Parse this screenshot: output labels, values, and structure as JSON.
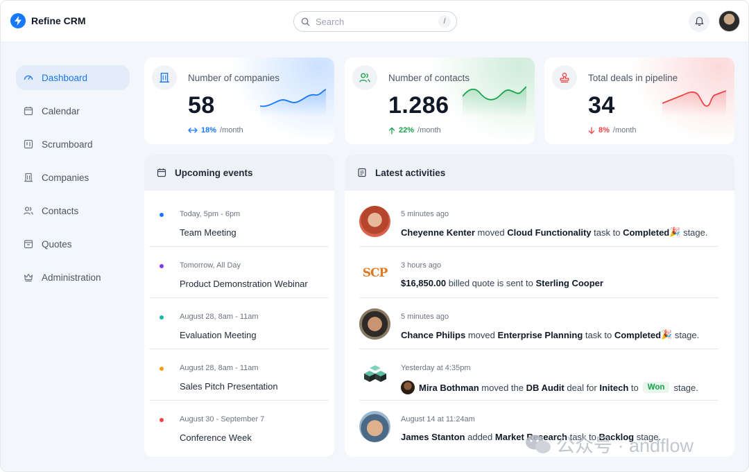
{
  "app": {
    "name": "Refine CRM"
  },
  "search": {
    "placeholder": "Search",
    "shortcut": "/"
  },
  "sidebar": {
    "items": [
      {
        "label": "Dashboard",
        "icon": "gauge-icon",
        "active": true
      },
      {
        "label": "Calendar",
        "icon": "calendar-icon"
      },
      {
        "label": "Scrumboard",
        "icon": "board-icon"
      },
      {
        "label": "Companies",
        "icon": "building-icon"
      },
      {
        "label": "Contacts",
        "icon": "users-icon"
      },
      {
        "label": "Quotes",
        "icon": "inbox-icon"
      },
      {
        "label": "Administration",
        "icon": "crown-icon"
      }
    ]
  },
  "kpis": [
    {
      "title": "Number of companies",
      "value": "58",
      "pct": "18%",
      "unit": "/month",
      "trend": "flat",
      "color": "#1677ff"
    },
    {
      "title": "Number of contacts",
      "value": "1.286",
      "pct": "22%",
      "unit": "/month",
      "trend": "up",
      "color": "#16a34a"
    },
    {
      "title": "Total deals in pipeline",
      "value": "34",
      "pct": "8%",
      "unit": "/month",
      "trend": "down",
      "color": "#ef4444"
    }
  ],
  "events": {
    "title": "Upcoming events",
    "items": [
      {
        "date": "Today, 5pm - 6pm",
        "title": "Team Meeting",
        "color": "#1677ff"
      },
      {
        "date": "Tomorrow, All Day",
        "title": "Product Demonstration Webinar",
        "color": "#7c3aed"
      },
      {
        "date": "August 28, 8am - 11am",
        "title": "Evaluation Meeting",
        "color": "#14b8a6"
      },
      {
        "date": "August 28, 8am - 11am",
        "title": "Sales Pitch Presentation",
        "color": "#f59e0b"
      },
      {
        "date": "August 30 - September 7",
        "title": "Conference Week",
        "color": "#ef4444"
      }
    ]
  },
  "activities": {
    "title": "Latest activities",
    "items": [
      {
        "time": "5 minutes ago",
        "parts": [
          "Cheyenne Kenter",
          "moved",
          "Cloud Functionality",
          "task to",
          "Completed",
          "stage."
        ]
      },
      {
        "time": "3 hours ago",
        "parts": [
          "$16,850.00",
          "billed quote is sent to",
          "Sterling Cooper"
        ],
        "logo_text": "SCP"
      },
      {
        "time": "5 minutes ago",
        "parts": [
          "Chance Philips",
          "moved",
          "Enterprise Planning",
          "task to",
          "Completed",
          "stage."
        ]
      },
      {
        "time": "Yesterday at 4:35pm",
        "parts": [
          "Mira Bothman",
          "moved the",
          "DB Audit",
          "deal for",
          "Initech",
          "to",
          "Won",
          "stage."
        ]
      },
      {
        "time": "August 14 at 11:24am",
        "parts": [
          "James Stanton",
          "added",
          "Market Research",
          "task to",
          "Backlog",
          "stage."
        ]
      }
    ]
  },
  "watermark": {
    "text": "公众号 · andflow"
  }
}
